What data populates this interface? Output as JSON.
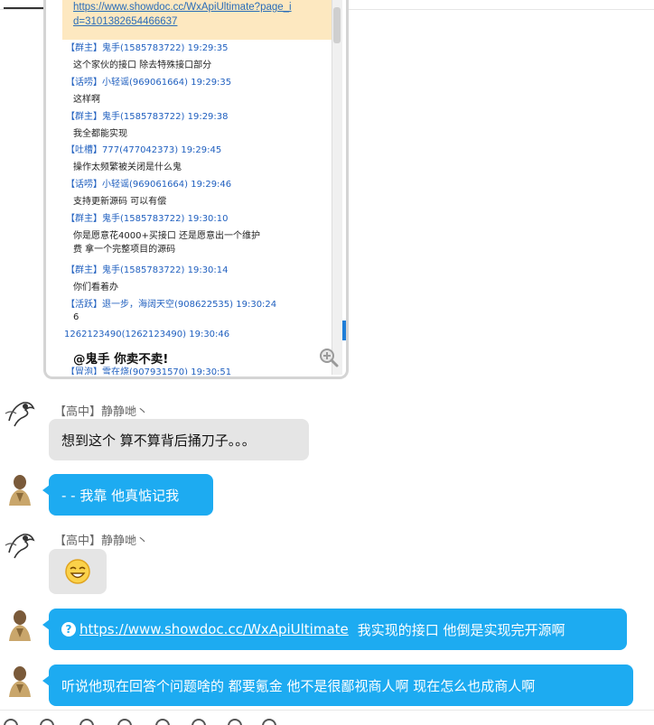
{
  "shared_image": {
    "url_lines": [
      "https://www.showdoc.cc/WxApiUltimate?page_i",
      "d=3101382654466637"
    ],
    "lines": [
      {
        "kind": "head",
        "text": "【群主】鬼手(1585783722) 19:29:35"
      },
      {
        "kind": "body",
        "text": "这个家伙的接口 除去特殊接口部分"
      },
      {
        "kind": "head",
        "text": "【话唠】小轻谣(969061664) 19:29:35"
      },
      {
        "kind": "body",
        "text": "这样啊"
      },
      {
        "kind": "head",
        "text": "【群主】鬼手(1585783722) 19:29:38"
      },
      {
        "kind": "body",
        "text": "我全都能实现"
      },
      {
        "kind": "head",
        "text": "【吐槽】777(477042373) 19:29:45"
      },
      {
        "kind": "body",
        "text": "操作太频繁被关闭是什么鬼"
      },
      {
        "kind": "head",
        "text": "【话唠】小轻谣(969061664) 19:29:46"
      },
      {
        "kind": "body",
        "text": "支持更新源码 可以有偿"
      },
      {
        "kind": "head",
        "text": "【群主】鬼手(1585783722) 19:30:10"
      },
      {
        "kind": "body",
        "text": "你是愿意花4000+买接口  还是愿意出一个维护"
      },
      {
        "kind": "body",
        "text": "费 拿一个完整项目的源码"
      },
      {
        "kind": "head",
        "text": "【群主】鬼手(1585783722) 19:30:14"
      },
      {
        "kind": "body",
        "text": "你们看着办"
      },
      {
        "kind": "head",
        "text": "【活跃】退一步，海阔天空(908622535) 19:30:24"
      },
      {
        "kind": "body",
        "text": "6"
      },
      {
        "kind": "head2",
        "text": "1262123490(1262123490) 19:30:46"
      },
      {
        "kind": "big",
        "text": "@鬼手 你卖不卖!"
      },
      {
        "kind": "head",
        "text": "【冒泡】雪在烧(907931570) 19:30:51"
      }
    ]
  },
  "messages": [
    {
      "sender": "【高中】静静哋丶",
      "text": "想到这个 算不算背后捅刀子。。。"
    },
    {
      "text": "- - 我靠  他真惦记我"
    },
    {
      "sender": "【高中】静静哋丶",
      "emoji": "grin-emoji"
    },
    {
      "link": "https://www.showdoc.cc/WxApiUltimate",
      "text": "我实现的接口 他倒是实现完开源啊"
    },
    {
      "text": "听说他现在回答个问题啥的 都要氪金     他不是很鄙视商人啊  现在怎么也成商人啊"
    }
  ],
  "colors": {
    "bubble_blue": "#1dabf1",
    "bubble_grey": "#e5e5e5",
    "name_blue": "#1f5fbf"
  }
}
